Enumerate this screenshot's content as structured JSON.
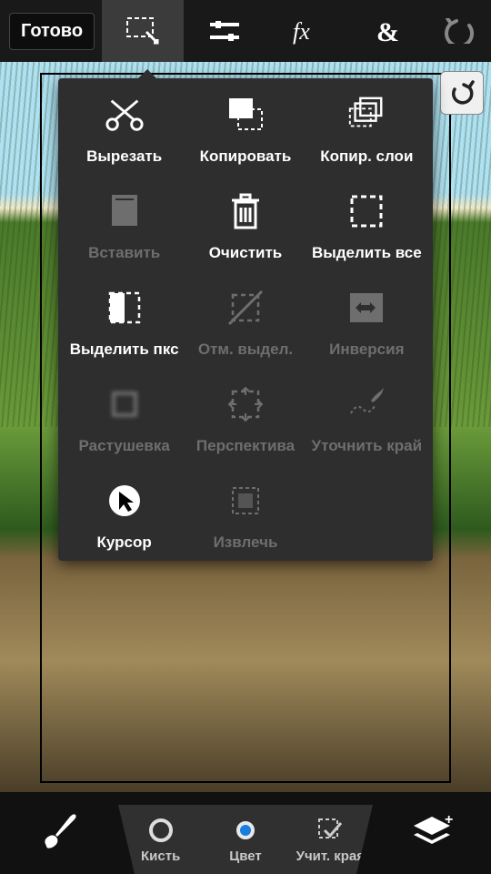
{
  "topbar": {
    "done_label": "Готово"
  },
  "panel": {
    "items": [
      {
        "label": "Вырезать",
        "icon": "cut",
        "enabled": true
      },
      {
        "label": "Копировать",
        "icon": "copy",
        "enabled": true
      },
      {
        "label": "Копир. слои",
        "icon": "copy-layers",
        "enabled": true
      },
      {
        "label": "Вставить",
        "icon": "paste",
        "enabled": false
      },
      {
        "label": "Очистить",
        "icon": "trash",
        "enabled": true
      },
      {
        "label": "Выделить все",
        "icon": "select-all",
        "enabled": true
      },
      {
        "label": "Выделить пкс",
        "icon": "select-px",
        "enabled": true
      },
      {
        "label": "Отм. выдел.",
        "icon": "deselect",
        "enabled": false
      },
      {
        "label": "Инверсия",
        "icon": "inverse",
        "enabled": false
      },
      {
        "label": "Растушевка",
        "icon": "feather",
        "enabled": false
      },
      {
        "label": "Перспектива",
        "icon": "perspective",
        "enabled": false
      },
      {
        "label": "Уточнить край",
        "icon": "refine",
        "enabled": false
      },
      {
        "label": "Курсор",
        "icon": "cursor",
        "enabled": true
      },
      {
        "label": "Извлечь",
        "icon": "extract",
        "enabled": false
      }
    ]
  },
  "bottombar": {
    "brush": "Кисть",
    "color": "Цвет",
    "edges": "Учит. края"
  }
}
